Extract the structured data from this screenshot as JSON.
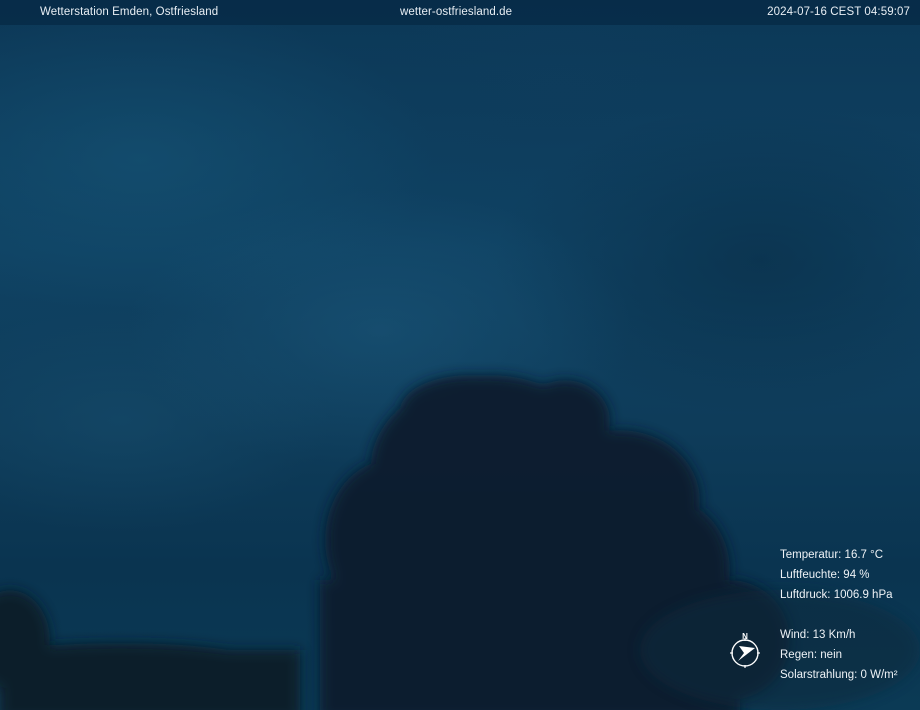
{
  "header": {
    "station": "Wetterstation Emden, Ostfriesland",
    "website": "wetter-ostfriesland.de",
    "timestamp": "2024-07-16 CEST 04:59:07"
  },
  "readings": {
    "temperature": "Temperatur: 16.7 °C",
    "humidity": "Luftfeuchte: 94 %",
    "pressure": "Luftdruck: 1006.9 hPa",
    "wind": "Wind: 13 Km/h",
    "rain": "Regen: nein",
    "solar": "Solarstrahlung: 0 W/m²"
  },
  "compass": {
    "north_label": "N",
    "icon": "wind-direction-compass-icon"
  },
  "colors": {
    "sky": "#0e3c5a",
    "tree": "#06202f",
    "text": "#ffffff"
  }
}
